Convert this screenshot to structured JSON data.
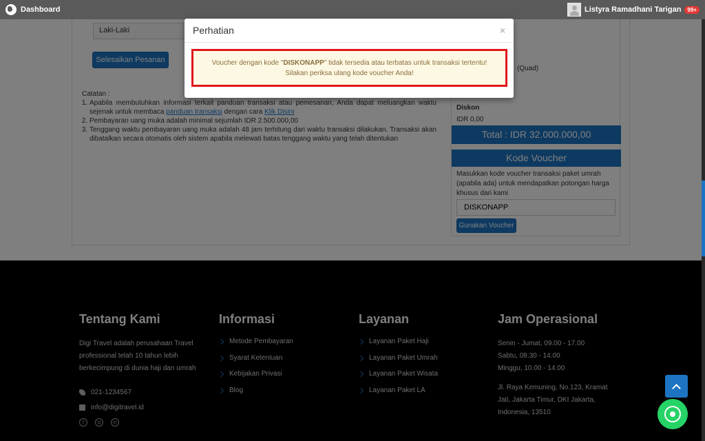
{
  "nav": {
    "brand": "Dashboard",
    "user_name": "Listyra Ramadhani Tarigan",
    "badge": "99+"
  },
  "form": {
    "gender_value": "Laki-Laki",
    "finish_button": "Selesaikan Pesanan"
  },
  "notes": {
    "heading": "Catatan :",
    "item1_part1": "Apabila membutuhkan informasi terkait panduan transaksi atau pemesanan, Anda dapat meluangkan waktu sejenak untuk membaca ",
    "item1_link1": "panduan transaksi",
    "item1_part2": " dengan cara ",
    "item1_link2": "Klik Disini",
    "item2": "Pembayaran uang muka adalah minimal sejumlah IDR 2.500.000,00",
    "item3": "Tenggang waktu pembayaran uang muka adalah 48 jam terhitung dari waktu transaksi dilakukan. Transaksi akan dibatalkan secara otomatis oleh sistem apabila melewati batas tenggang waktu yang telah ditentukan"
  },
  "summary": {
    "room_type": "(Quad)",
    "discount_label": "Diskon",
    "discount_value": "IDR 0,00",
    "total": "Total : IDR 32.000.000,00"
  },
  "voucher": {
    "title": "Kode Voucher",
    "description": "Masukkan kode voucher transaksi paket umrah (apabila ada) untuk mendapatkan potongan harga khusus dari kami",
    "code": "DISKONAPP",
    "button": "Gunakan Voucher"
  },
  "modal": {
    "title": "Perhatian",
    "close": "×",
    "msg_prefix": "Voucher dengan kode \"",
    "msg_code": "DISKONAPP",
    "msg_suffix": "\" tidak tersedia atau terbatas untuk transaksi tertentu! Silakan periksa ulang kode voucher Anda!"
  },
  "footer": {
    "about": {
      "title": "Tentang Kami",
      "text": "Digi Travel adalah perusahaan Travel professional telah 10 tahun lebih berkecimpung di dunia haji dan umrah",
      "phone": "021-1234567",
      "email": "info@digitravel.id"
    },
    "info": {
      "title": "Informasi",
      "items": [
        "Metode Pembayaran",
        "Syarat Ketentuan",
        "Kebijakan Privasi",
        "Blog"
      ]
    },
    "services": {
      "title": "Layanan",
      "items": [
        "Layanan Paket Haji",
        "Layanan Paket Umrah",
        "Layanan Paket Wisata",
        "Layanan Paket LA"
      ]
    },
    "hours": {
      "title": "Jam Operasional",
      "line1": "Senin - Jumat, 09.00 - 17.00",
      "line2": "Sabtu, 08.30 - 14.00",
      "line3": "Minggu, 10.00 - 14.00",
      "address": "Jl. Raya Kemuning, No.123, Kramat Jati, Jakarta Timur, DKI Jakarta, Indonesia, 13510"
    }
  },
  "colors": {
    "primary": "#1d74c3",
    "alert_border": "#e0151b",
    "alert_bg": "#fcf8e3",
    "whatsapp": "#25d366"
  },
  "icons": [
    "globe-icon",
    "avatar",
    "chevron-right-icon",
    "phone-icon",
    "mail-icon",
    "facebook-icon",
    "instagram-icon",
    "linkedin-icon",
    "arrow-up-icon",
    "whatsapp-icon",
    "close-icon"
  ]
}
